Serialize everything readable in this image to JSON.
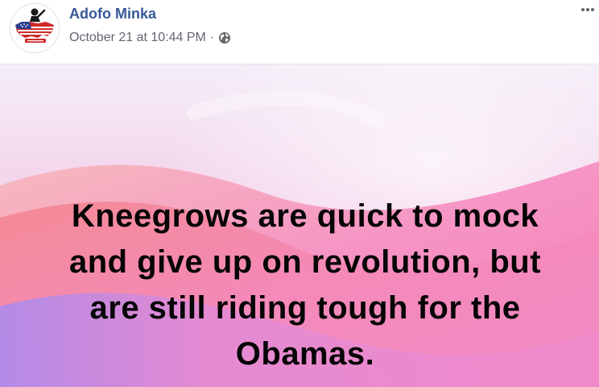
{
  "post": {
    "author": "Adofo Minka",
    "timestamp": "October 21 at 10:44 PM",
    "separator": "·",
    "privacy_icon": "globe-icon",
    "more_icon": "ellipsis-icon",
    "avatar_icon": "us-map-logo-icon",
    "text_lines": [
      "Kneegrows are quick to mock",
      "and give up on revolution, but",
      "are still riding tough for the",
      "Obamas."
    ]
  },
  "colors": {
    "author_link": "#385898",
    "meta_text": "#616770",
    "post_text": "#050505",
    "bg_top": "#f6eef8",
    "bg_pink": "#f59bd0",
    "bg_orange": "#f57a7a",
    "bg_purple": "#b68cf0"
  }
}
